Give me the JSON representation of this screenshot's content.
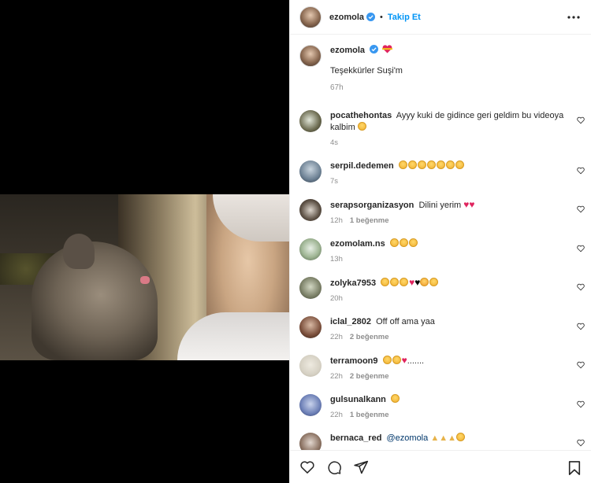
{
  "post": {
    "author": "ezomola",
    "separator": "•",
    "follow_label": "Takip Et",
    "caption_author": "ezomola",
    "caption_text": "Teşekkürler Suşi'm",
    "caption_time": "67h",
    "caption_emoji": "heart-with-ribbon"
  },
  "comments": [
    {
      "user": "pocathehontas",
      "text": "Ayyy kuki de gidince geri geldim bu videoya kalbim",
      "emojis": [
        "sad-face"
      ],
      "time": "4s",
      "likes": ""
    },
    {
      "user": "serpil.dedemen",
      "text": "",
      "emojis": [
        "sad-face",
        "sad-face",
        "sad-face",
        "sad-face",
        "sad-face",
        "sad-face",
        "sad-face"
      ],
      "time": "7s",
      "likes": ""
    },
    {
      "user": "serapsorganizasyon",
      "text": "Dilini yerim",
      "emojis": [
        "red-heart",
        "red-heart"
      ],
      "time": "12h",
      "likes": "1 beğenme"
    },
    {
      "user": "ezomolam.ns",
      "text": "",
      "emojis": [
        "sad-face",
        "sad-face",
        "sad-face"
      ],
      "time": "13h",
      "likes": ""
    },
    {
      "user": "zolyka7953",
      "text": "",
      "emojis": [
        "sad-face",
        "sad-face",
        "sad-face",
        "broken-heart",
        "black-heart",
        "heart-eyes",
        "sad-face"
      ],
      "time": "20h",
      "likes": ""
    },
    {
      "user": "iclal_2802",
      "text": "Off off ama yaa",
      "emojis": [],
      "time": "22h",
      "likes": "2 beğenme"
    },
    {
      "user": "terramoon9",
      "text": ".......",
      "emojis": [
        "sad-face",
        "crying-face",
        "red-heart"
      ],
      "time": "22h",
      "likes": "2 beğenme"
    },
    {
      "user": "gulsunalkann",
      "text": "",
      "emojis": [
        "sad-face"
      ],
      "time": "22h",
      "likes": "1 beğenme"
    },
    {
      "user": "bernaca_red",
      "text": "@ezomola",
      "emojis": [
        "folded-hands",
        "folded-hands",
        "folded-hands",
        "sad-face"
      ],
      "time": "",
      "likes": ""
    }
  ],
  "icons": {
    "more": "more-horizontal-icon",
    "verified": "verified-badge-icon",
    "like": "heart-outline-icon",
    "comment": "comment-bubble-icon",
    "share": "paper-plane-icon",
    "save": "bookmark-icon"
  },
  "colors": {
    "link_blue": "#0095f6",
    "text": "#262626",
    "muted": "#8e8e8e",
    "verified": "#3897f0",
    "heart": "#e0245e"
  }
}
